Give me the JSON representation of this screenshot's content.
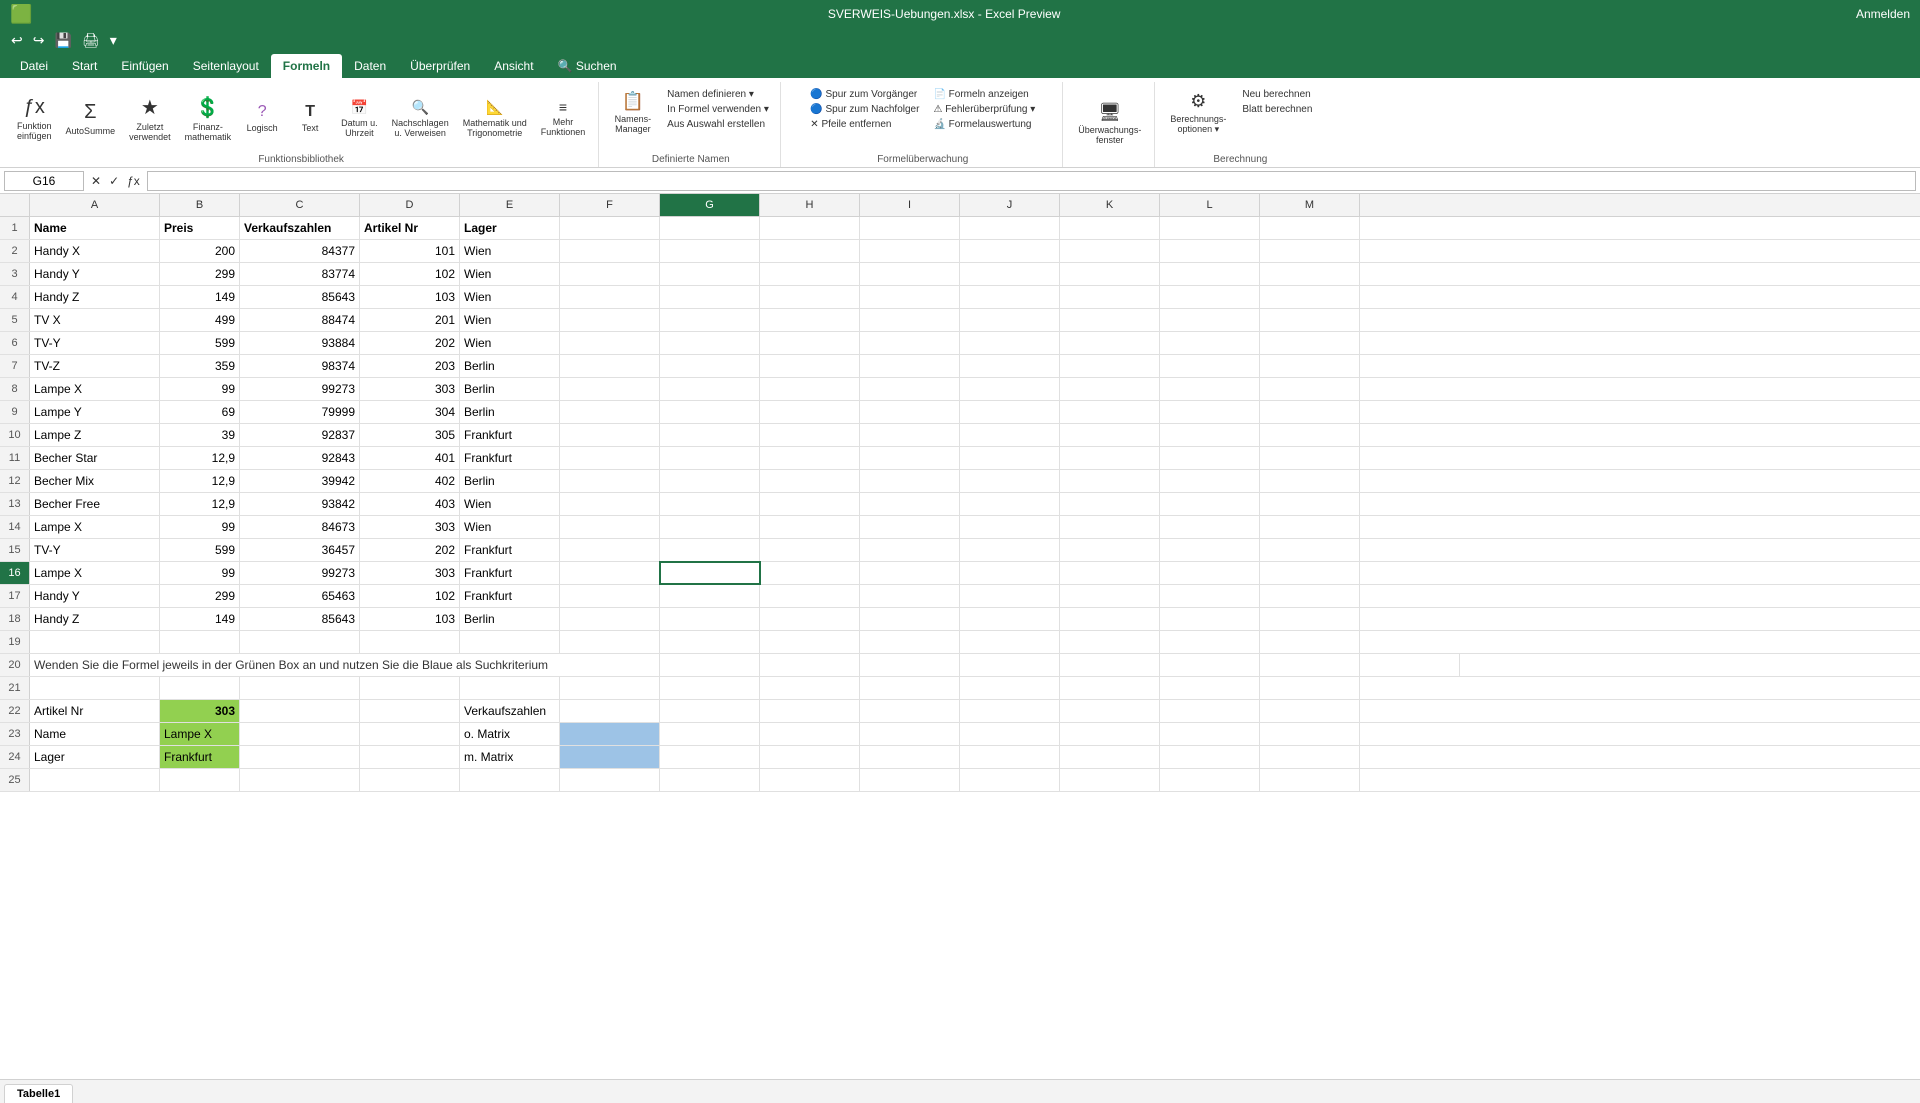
{
  "titleBar": {
    "title": "SVERWEIS-Uebungen.xlsx - Excel Preview",
    "anmelden": "Anmelden"
  },
  "quickAccess": {
    "buttons": [
      "↩",
      "↪",
      "💾",
      "🖨",
      "↩",
      "▾"
    ]
  },
  "ribbonTabs": [
    {
      "label": "Datei",
      "active": false
    },
    {
      "label": "Start",
      "active": false
    },
    {
      "label": "Einfügen",
      "active": false
    },
    {
      "label": "Seitenlayout",
      "active": false
    },
    {
      "label": "Formeln",
      "active": true
    },
    {
      "label": "Daten",
      "active": false
    },
    {
      "label": "Überprüfen",
      "active": false
    },
    {
      "label": "Ansicht",
      "active": false
    },
    {
      "label": "🔍 Suchen",
      "active": false
    }
  ],
  "ribbon": {
    "groups": [
      {
        "label": "",
        "buttons": [
          {
            "icon": "ƒx",
            "label": "Funktion\neinfügen"
          },
          {
            "icon": "Σ",
            "label": "AutoSumme"
          },
          {
            "icon": "★",
            "label": "Zuletzt\nverwendet"
          },
          {
            "icon": "💲",
            "label": "Finanz-\nmathematik"
          },
          {
            "icon": "?",
            "label": "Logisch"
          },
          {
            "icon": "T",
            "label": "Text"
          },
          {
            "icon": "📅",
            "label": "Datum u.\nUhrzeit"
          },
          {
            "icon": "🔍",
            "label": "Nachschlagen\nu. Verweisen"
          },
          {
            "icon": "π",
            "label": "Mathematik und\nTrigonometrie"
          },
          {
            "icon": "≡",
            "label": "Mehr\nFunktionen"
          }
        ],
        "groupLabel": "Funktionsbibliothek"
      },
      {
        "label": "Namens-Manager",
        "subItems": [
          "Namen definieren ▾",
          "In Formel verwenden ▾",
          "Aus Auswahl erstellen"
        ],
        "groupLabel": "Definierte Namen"
      },
      {
        "label": "",
        "subItems": [
          "Spur zum Vorgänger",
          "Spur zum Nachfolger",
          "Pfeile entfernen",
          "Formeln anzeigen",
          "Fehlerüberprüfung ▾",
          "Formelauswertung"
        ],
        "groupLabel": "Formelüberwachung"
      },
      {
        "label": "Überwachungs-\nfenster",
        "groupLabel": ""
      },
      {
        "label": "",
        "subItems": [
          "Neu berechnen",
          "Blatt berechnen"
        ],
        "groupLabel": "Berechnung",
        "hasOptions": "Berechnungs-\noptionen ▾"
      }
    ]
  },
  "formulaBar": {
    "cellRef": "G16",
    "formula": ""
  },
  "columns": [
    "A",
    "B",
    "C",
    "D",
    "E",
    "F",
    "G",
    "H",
    "I",
    "J",
    "K",
    "L",
    "M"
  ],
  "rows": [
    {
      "num": 1,
      "cells": {
        "A": "Name",
        "B": "Preis",
        "C": "Verkaufszahlen",
        "D": "Artikel Nr",
        "E": "Lager",
        "F": "",
        "G": "",
        "H": "",
        "I": "",
        "J": "",
        "K": "",
        "L": "",
        "M": ""
      }
    },
    {
      "num": 2,
      "cells": {
        "A": "Handy X",
        "B": "200",
        "C": "84377",
        "D": "101",
        "E": "Wien",
        "F": "",
        "G": "",
        "H": "",
        "I": "",
        "J": "",
        "K": "",
        "L": "",
        "M": ""
      }
    },
    {
      "num": 3,
      "cells": {
        "A": "Handy Y",
        "B": "299",
        "C": "83774",
        "D": "102",
        "E": "Wien",
        "F": "",
        "G": "",
        "H": "",
        "I": "",
        "J": "",
        "K": "",
        "L": "",
        "M": ""
      }
    },
    {
      "num": 4,
      "cells": {
        "A": "Handy Z",
        "B": "149",
        "C": "85643",
        "D": "103",
        "E": "Wien",
        "F": "",
        "G": "",
        "H": "",
        "I": "",
        "J": "",
        "K": "",
        "L": "",
        "M": ""
      }
    },
    {
      "num": 5,
      "cells": {
        "A": "TV X",
        "B": "499",
        "C": "88474",
        "D": "201",
        "E": "Wien",
        "F": "",
        "G": "",
        "H": "",
        "I": "",
        "J": "",
        "K": "",
        "L": "",
        "M": ""
      }
    },
    {
      "num": 6,
      "cells": {
        "A": "TV-Y",
        "B": "599",
        "C": "93884",
        "D": "202",
        "E": "Wien",
        "F": "",
        "G": "",
        "H": "",
        "I": "",
        "J": "",
        "K": "",
        "L": "",
        "M": ""
      }
    },
    {
      "num": 7,
      "cells": {
        "A": "TV-Z",
        "B": "359",
        "C": "98374",
        "D": "203",
        "E": "Berlin",
        "F": "",
        "G": "",
        "H": "",
        "I": "",
        "J": "",
        "K": "",
        "L": "",
        "M": ""
      }
    },
    {
      "num": 8,
      "cells": {
        "A": "Lampe X",
        "B": "99",
        "C": "99273",
        "D": "303",
        "E": "Berlin",
        "F": "",
        "G": "",
        "H": "",
        "I": "",
        "J": "",
        "K": "",
        "L": "",
        "M": ""
      }
    },
    {
      "num": 9,
      "cells": {
        "A": "Lampe Y",
        "B": "69",
        "C": "79999",
        "D": "304",
        "E": "Berlin",
        "F": "",
        "G": "",
        "H": "",
        "I": "",
        "J": "",
        "K": "",
        "L": "",
        "M": ""
      }
    },
    {
      "num": 10,
      "cells": {
        "A": "Lampe Z",
        "B": "39",
        "C": "92837",
        "D": "305",
        "E": "Frankfurt",
        "F": "",
        "G": "",
        "H": "",
        "I": "",
        "J": "",
        "K": "",
        "L": "",
        "M": ""
      }
    },
    {
      "num": 11,
      "cells": {
        "A": "Becher Star",
        "B": "12,9",
        "C": "92843",
        "D": "401",
        "E": "Frankfurt",
        "F": "",
        "G": "",
        "H": "",
        "I": "",
        "J": "",
        "K": "",
        "L": "",
        "M": ""
      }
    },
    {
      "num": 12,
      "cells": {
        "A": "Becher Mix",
        "B": "12,9",
        "C": "39942",
        "D": "402",
        "E": "Berlin",
        "F": "",
        "G": "",
        "H": "",
        "I": "",
        "J": "",
        "K": "",
        "L": "",
        "M": ""
      }
    },
    {
      "num": 13,
      "cells": {
        "A": "Becher Free",
        "B": "12,9",
        "C": "93842",
        "D": "403",
        "E": "Wien",
        "F": "",
        "G": "",
        "H": "",
        "I": "",
        "J": "",
        "K": "",
        "L": "",
        "M": ""
      }
    },
    {
      "num": 14,
      "cells": {
        "A": "Lampe X",
        "B": "99",
        "C": "84673",
        "D": "303",
        "E": "Wien",
        "F": "",
        "G": "",
        "H": "",
        "I": "",
        "J": "",
        "K": "",
        "L": "",
        "M": ""
      }
    },
    {
      "num": 15,
      "cells": {
        "A": "TV-Y",
        "B": "599",
        "C": "36457",
        "D": "202",
        "E": "Frankfurt",
        "F": "",
        "G": "",
        "H": "",
        "I": "",
        "J": "",
        "K": "",
        "L": "",
        "M": ""
      }
    },
    {
      "num": 16,
      "cells": {
        "A": "Lampe X",
        "B": "99",
        "C": "99273",
        "D": "303",
        "E": "Frankfurt",
        "F": "",
        "G": "SELECTED",
        "H": "",
        "I": "",
        "J": "",
        "K": "",
        "L": "",
        "M": ""
      }
    },
    {
      "num": 17,
      "cells": {
        "A": "Handy Y",
        "B": "299",
        "C": "65463",
        "D": "102",
        "E": "Frankfurt",
        "F": "",
        "G": "",
        "H": "",
        "I": "",
        "J": "",
        "K": "",
        "L": "",
        "M": ""
      }
    },
    {
      "num": 18,
      "cells": {
        "A": "Handy Z",
        "B": "149",
        "C": "85643",
        "D": "103",
        "E": "Berlin",
        "F": "",
        "G": "",
        "H": "",
        "I": "",
        "J": "",
        "K": "",
        "L": "",
        "M": ""
      }
    },
    {
      "num": 19,
      "cells": {
        "A": "",
        "B": "",
        "C": "",
        "D": "",
        "E": "",
        "F": "",
        "G": "",
        "H": "",
        "I": "",
        "J": "",
        "K": "",
        "L": "",
        "M": ""
      }
    },
    {
      "num": 20,
      "cells": {
        "A": "Wenden Sie die Formel jeweils in der Grünen Box an und nutzen Sie die Blaue als Suchkriterium",
        "B": "",
        "C": "",
        "D": "",
        "E": "",
        "F": "",
        "G": "",
        "H": "",
        "I": "",
        "J": "",
        "K": "",
        "L": "",
        "M": ""
      }
    },
    {
      "num": 21,
      "cells": {
        "A": "",
        "B": "",
        "C": "",
        "D": "",
        "E": "",
        "F": "",
        "G": "",
        "H": "",
        "I": "",
        "J": "",
        "K": "",
        "L": "",
        "M": ""
      }
    },
    {
      "num": 22,
      "cells": {
        "A": "Artikel Nr",
        "B": "303",
        "C": "",
        "D": "",
        "E": "Verkaufszahlen",
        "F": "",
        "G": "",
        "H": "",
        "I": "",
        "J": "",
        "K": "",
        "L": "",
        "M": ""
      }
    },
    {
      "num": 23,
      "cells": {
        "A": "Name",
        "B": "Lampe X",
        "C": "",
        "D": "",
        "E": "o. Matrix",
        "F": "BLUE",
        "G": "",
        "H": "",
        "I": "",
        "J": "",
        "K": "",
        "L": "",
        "M": ""
      }
    },
    {
      "num": 24,
      "cells": {
        "A": "Lager",
        "B": "Frankfurt",
        "C": "",
        "D": "",
        "E": "m. Matrix",
        "F": "BLUE",
        "G": "",
        "H": "",
        "I": "",
        "J": "",
        "K": "",
        "L": "",
        "M": ""
      }
    },
    {
      "num": 25,
      "cells": {
        "A": "",
        "B": "",
        "C": "",
        "D": "",
        "E": "",
        "F": "",
        "G": "",
        "H": "",
        "I": "",
        "J": "",
        "K": "",
        "L": "",
        "M": ""
      }
    }
  ],
  "sheetTabs": [
    "Tabelle1"
  ],
  "colors": {
    "greenBg": "#92d050",
    "blueBg": "#9dc3e6",
    "selectedBorder": "#217346",
    "ribbonGreen": "#217346"
  }
}
